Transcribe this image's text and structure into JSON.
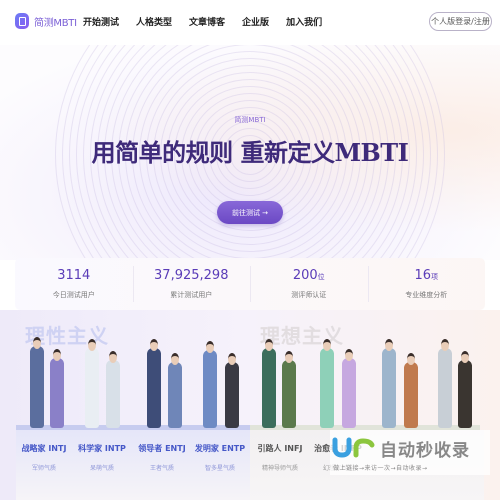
{
  "header": {
    "logo_text": "简测MBTI",
    "nav": [
      "开始测试",
      "人格类型",
      "文章博客",
      "企业版",
      "加入我们"
    ],
    "login_label": "个人版登录/注册"
  },
  "hero": {
    "brand": "简测MBTI",
    "title": "用简单的规则 重新定义MBTI",
    "cta_label": "前往测试 →"
  },
  "stats": [
    {
      "value": "3114",
      "unit": "",
      "label": "今日测试用户"
    },
    {
      "value": "37,925,298",
      "unit": "",
      "label": "累计测试用户"
    },
    {
      "value": "200",
      "unit": "位",
      "label": "测评师认证"
    },
    {
      "value": "16",
      "unit": "项",
      "label": "专业维度分析"
    }
  ],
  "groups": [
    {
      "title": "理性主义",
      "types": [
        {
          "name": "战略家 INTJ",
          "tag": "军师气质"
        },
        {
          "name": "科学家 INTP",
          "tag": "呆萌气质"
        },
        {
          "name": "领导者 ENTJ",
          "tag": "王者气质"
        },
        {
          "name": "发明家 ENTP",
          "tag": "智多星气质"
        }
      ]
    },
    {
      "title": "理想主义",
      "types": [
        {
          "name": "引路人 INFJ",
          "tag": "精神导师气质"
        },
        {
          "name": "治愈者 INFP",
          "tag": "幻想家气质"
        }
      ]
    }
  ],
  "watermark": {
    "title": "自动秒收录",
    "subtitle": "做上链接→来访一次→自动收录→"
  },
  "colors": {
    "brand": "#6b48c4",
    "title": "#3e2a7a",
    "rational": "#4658c8"
  }
}
